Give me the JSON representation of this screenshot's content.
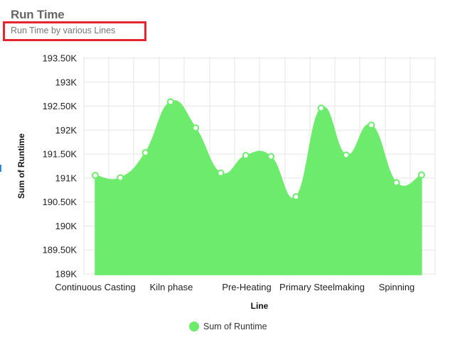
{
  "header": {
    "title": "Run Time",
    "subtitle": "Run Time by various Lines"
  },
  "colors": {
    "series_fill": "#6deb6d",
    "point_stroke": "#6deb6d",
    "point_fill": "#ffffff",
    "grid": "#e6e6e6",
    "highlight": "#e3262f"
  },
  "chart_data": {
    "type": "area",
    "title": "Run Time",
    "subtitle": "Run Time by various Lines",
    "xlabel": "Line",
    "ylabel": "Sum of Runtime",
    "x_tick_labels": [
      "Continuous Casting",
      "Kiln phase",
      "Pre-Heating",
      "Primary Steelmaking",
      "Spinning"
    ],
    "y_tick_labels": [
      "189K",
      "189.50K",
      "190K",
      "190.50K",
      "191K",
      "191.50K",
      "192K",
      "192.50K",
      "193K",
      "193.50K"
    ],
    "ylim": [
      189000,
      193500
    ],
    "y_ticks": [
      189000,
      189500,
      190000,
      190500,
      191000,
      191500,
      192000,
      192500,
      193000,
      193500
    ],
    "grid": true,
    "legend_position": "bottom",
    "series": [
      {
        "name": "Sum of Runtime",
        "values": [
          191050,
          191000,
          191520,
          192570,
          192030,
          191100,
          191460,
          191440,
          190610,
          192440,
          191470,
          192090,
          190900,
          191060
        ]
      }
    ]
  }
}
